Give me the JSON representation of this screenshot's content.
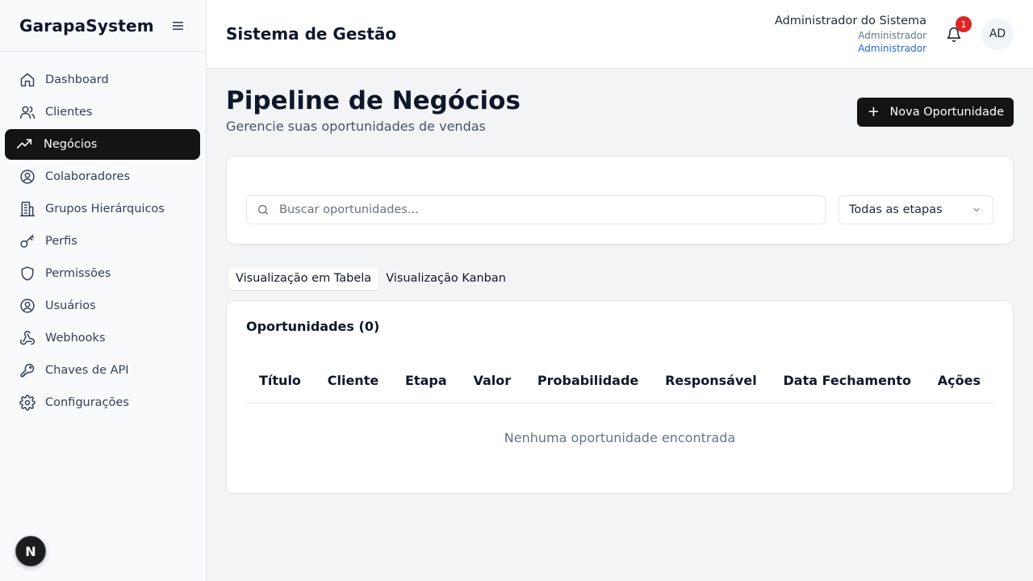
{
  "sidebar": {
    "brand": "GarapaSystem",
    "items": [
      {
        "label": "Dashboard",
        "icon": "home-icon"
      },
      {
        "label": "Clientes",
        "icon": "users-icon"
      },
      {
        "label": "Negócios",
        "icon": "trending-up-icon",
        "active": true
      },
      {
        "label": "Colaboradores",
        "icon": "user-circle-icon"
      },
      {
        "label": "Grupos Hierárquicos",
        "icon": "building-icon"
      },
      {
        "label": "Perfis",
        "icon": "key-icon"
      },
      {
        "label": "Permissões",
        "icon": "shield-icon"
      },
      {
        "label": "Usuários",
        "icon": "user-circle-icon"
      },
      {
        "label": "Webhooks",
        "icon": "webhook-icon"
      },
      {
        "label": "Chaves de API",
        "icon": "key-round-icon"
      },
      {
        "label": "Configurações",
        "icon": "gear-icon"
      }
    ],
    "dev_badge": "N"
  },
  "header": {
    "title": "Sistema de Gestão",
    "user_name": "Administrador do Sistema",
    "user_role": "Administrador",
    "user_role_link": "Administrador",
    "notification_count": "1",
    "avatar_initials": "AD"
  },
  "main": {
    "title": "Pipeline de Negócios",
    "subtitle": "Gerencie suas oportunidades de vendas",
    "new_button": "Nova Oportunidade",
    "search_placeholder": "Buscar oportunidades...",
    "stage_select": "Todas as etapas",
    "tabs": [
      {
        "label": "Visualização em Tabela",
        "active": true
      },
      {
        "label": "Visualização Kanban",
        "active": false
      }
    ],
    "table": {
      "title": "Oportunidades (0)",
      "columns": [
        "Título",
        "Cliente",
        "Etapa",
        "Valor",
        "Probabilidade",
        "Responsável",
        "Data Fechamento",
        "Ações"
      ],
      "empty_message": "Nenhuma oportunidade encontrada"
    }
  },
  "colors": {
    "active_nav_bg": "#141414",
    "primary_button": "#141414",
    "badge_red": "#dc2626",
    "link_blue": "#2563eb"
  }
}
